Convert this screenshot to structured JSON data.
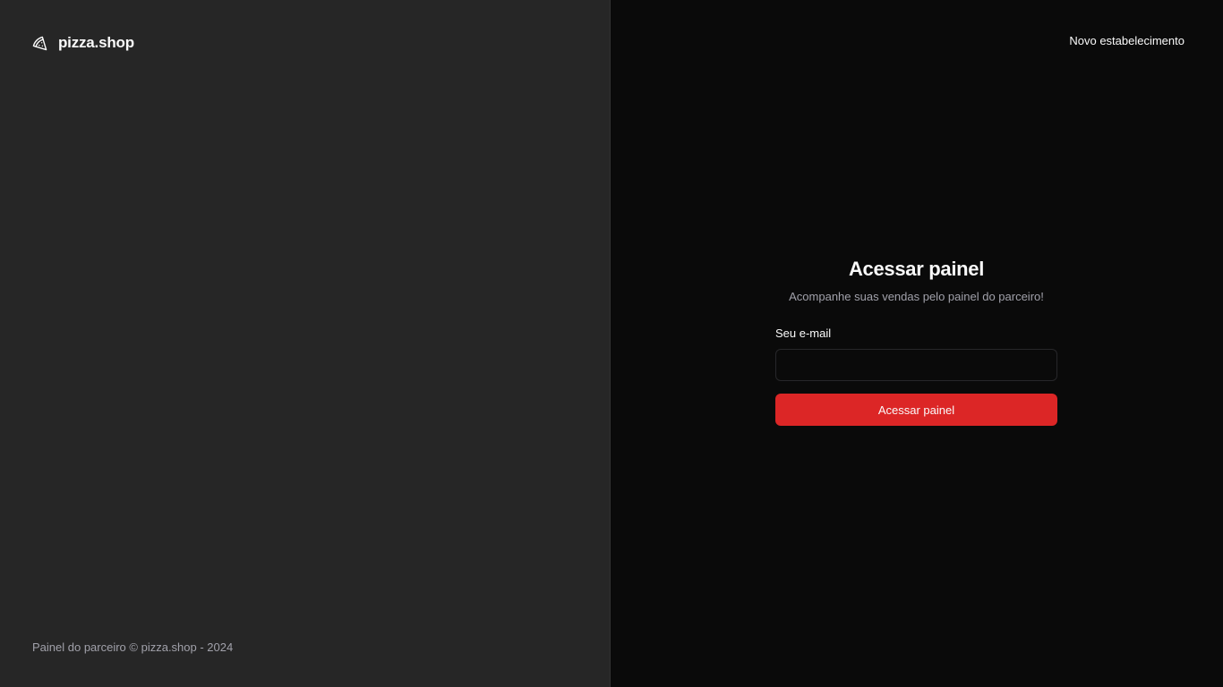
{
  "brand": {
    "icon": "pizza-icon",
    "name": "pizza.shop"
  },
  "footer": {
    "text": "Painel do parceiro © pizza.shop - 2024"
  },
  "header": {
    "new_store_link": "Novo estabelecimento"
  },
  "login": {
    "title": "Acessar painel",
    "subtitle": "Acompanhe suas vendas pelo painel do parceiro!",
    "email_label": "Seu e-mail",
    "email_value": "",
    "email_placeholder": "",
    "submit_label": "Acessar painel"
  },
  "colors": {
    "left_panel_bg": "#262626",
    "right_panel_bg": "#0a0a0a",
    "accent": "#dc2626",
    "muted_text": "#a1a1aa"
  }
}
